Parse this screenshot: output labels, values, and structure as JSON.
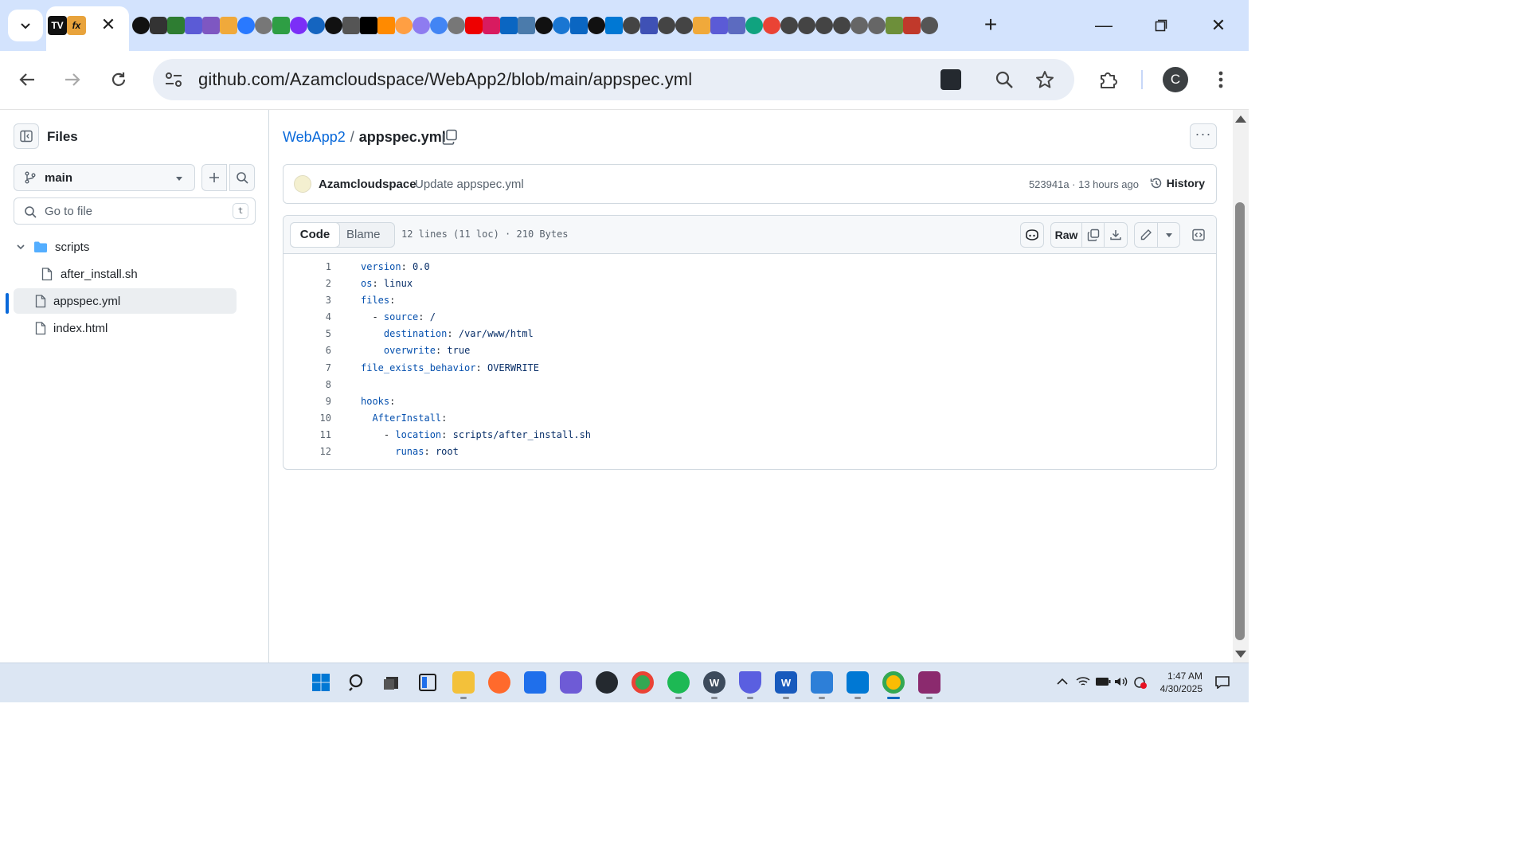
{
  "browser": {
    "url": "github.com/Azamcloudspace/WebApp2/blob/main/appspec.yml",
    "profile_initial": "C"
  },
  "sidebar": {
    "title": "Files",
    "branch": "main",
    "goto_placeholder": "Go to file",
    "goto_shortcut": "t",
    "tree": [
      {
        "type": "folder",
        "label": "scripts"
      },
      {
        "type": "file",
        "label": "after_install.sh"
      },
      {
        "type": "file",
        "label": "appspec.yml",
        "selected": true
      },
      {
        "type": "file",
        "label": "index.html"
      }
    ]
  },
  "breadcrumb": {
    "repo": "WebApp2",
    "separator": "/",
    "file": "appspec.yml"
  },
  "commit": {
    "author": "Azamcloudspace",
    "message": "Update appspec.yml",
    "meta": "523941a · 13 hours ago",
    "history_label": "History"
  },
  "file": {
    "tab_code": "Code",
    "tab_blame": "Blame",
    "info": "12 lines (11 loc) · 210 Bytes",
    "raw_label": "Raw",
    "lines": [
      {
        "n": "1",
        "indent": "",
        "key": "version",
        "value": "0.0"
      },
      {
        "n": "2",
        "indent": "",
        "key": "os",
        "value": "linux"
      },
      {
        "n": "3",
        "indent": "",
        "key": "files",
        "value": ""
      },
      {
        "n": "4",
        "indent": "  - ",
        "key": "source",
        "value": "/"
      },
      {
        "n": "5",
        "indent": "    ",
        "key": "destination",
        "value": "/var/www/html"
      },
      {
        "n": "6",
        "indent": "    ",
        "key": "overwrite",
        "value": "true"
      },
      {
        "n": "7",
        "indent": "",
        "key": "file_exists_behavior",
        "value": "OVERWRITE"
      },
      {
        "n": "8",
        "indent": "",
        "key": "",
        "value": ""
      },
      {
        "n": "9",
        "indent": "",
        "key": "hooks",
        "value": ""
      },
      {
        "n": "10",
        "indent": "  ",
        "key": "AfterInstall",
        "value": ""
      },
      {
        "n": "11",
        "indent": "    - ",
        "key": "location",
        "value": "scripts/after_install.sh"
      },
      {
        "n": "12",
        "indent": "      ",
        "key": "runas",
        "value": "root"
      }
    ]
  },
  "taskbar": {
    "time": "1:47 AM",
    "date": "4/30/2025"
  },
  "colors": {
    "link": "#0969da",
    "yaml_key": "#0550ae",
    "yaml_value": "#0a3069",
    "tabstrip": "#d3e3fd"
  }
}
